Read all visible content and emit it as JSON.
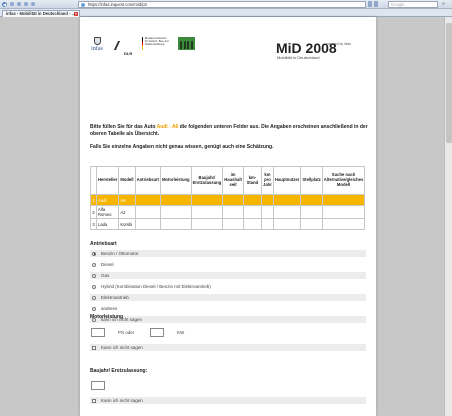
{
  "browser": {
    "url": "https://infas.inquest.com/mid/p3",
    "search_placeholder": "Google",
    "tab_title": "infas - Mobilität in Deutschland - ...",
    "tab_close": "✕"
  },
  "header": {
    "logo_infas": "infas",
    "logo_dlr": "DLR",
    "ministry_text": "Bundesministerium für Verkehr, Bau und Stadtentwicklung",
    "title": "MiD 2008",
    "subtitle": "Mobilität in Deutschland",
    "powered_by": "powered by infas"
  },
  "intro": {
    "line1_pre": "Bitte füllen Sie für das Auto ",
    "highlight": "Audi - A6",
    "line1_post": " die folgenden unteren Felder aus. Die Angaben erscheinen anschließend in der oberen Tabelle als Übersicht.",
    "line2": "Falls Sie einzelne Angaben nicht genau wissen, genügt auch eine Schätzung."
  },
  "table": {
    "headers": [
      "",
      "Hersteller",
      "Modell",
      "Antriebsart",
      "Motorleistung",
      "Baujahr/ Erstzulassung",
      "im Haushalt seit",
      "km-Stand",
      "km pro Jahr",
      "Hauptnutzer",
      "Stellplatz",
      "Suche nach Alternative/gleiches Modell"
    ],
    "rows": [
      {
        "num": "1",
        "maker": "Audi",
        "model": "A6"
      },
      {
        "num": "2",
        "maker": "Alfa Romeo",
        "model": "A2"
      },
      {
        "num": "3",
        "maker": "Lada",
        "model": "Kombi"
      }
    ]
  },
  "antrieb": {
    "title": "Antriebsart",
    "options": [
      "Benzin / Ottomotor",
      "Diesel",
      "Gas",
      "Hybrid (Kombination Diesel / Benzin mit Elektroantrieb)",
      "Elektroantrieb",
      "anderes",
      "kann ich nicht sagen"
    ],
    "selected_index": 0
  },
  "motor": {
    "title": "Motorleistung",
    "ps_label": "PS oder",
    "kw_label": "KW",
    "ps_value": "",
    "kw_value": "",
    "dont_know": "Kann ich nicht sagen"
  },
  "baujahr": {
    "title": "Baujahr/ Erstzulassung:",
    "value": "",
    "dont_know": "Kann ich nicht sagen"
  }
}
